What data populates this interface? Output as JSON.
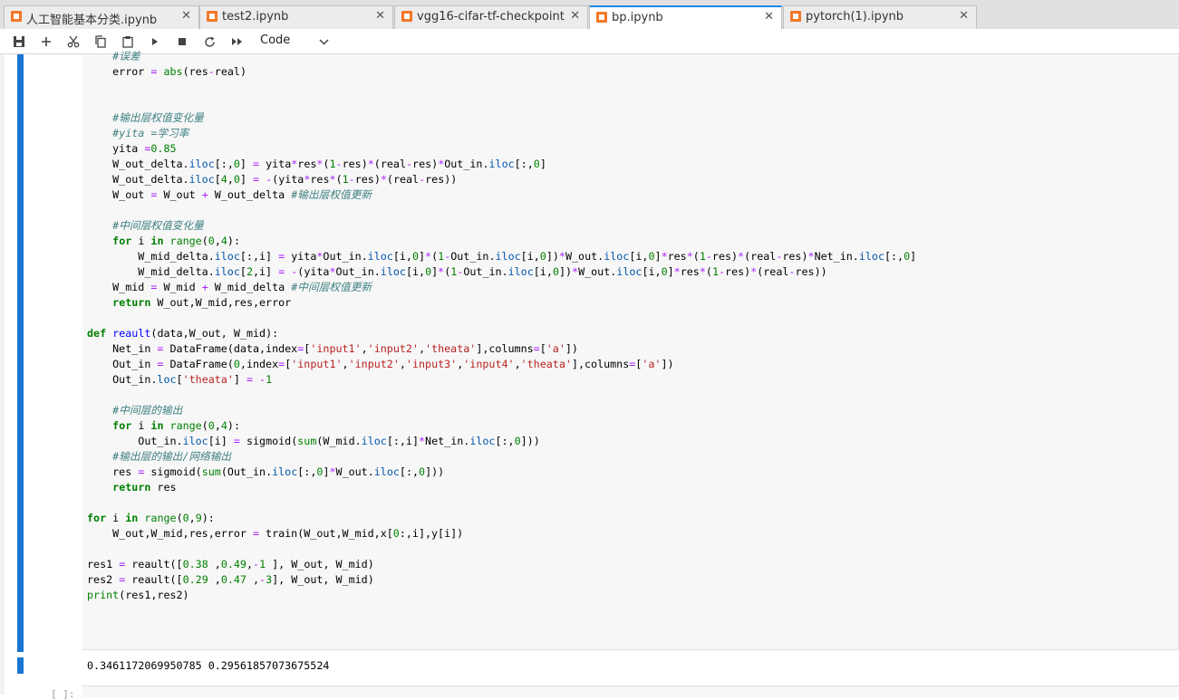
{
  "tabs": [
    {
      "label": "人工智能基本分类.ipynb",
      "active": false
    },
    {
      "label": "test2.ipynb",
      "active": false
    },
    {
      "label": "vgg16-cifar-tf-checkpoint.ipy",
      "active": false
    },
    {
      "label": "bp.ipynb",
      "active": true
    },
    {
      "label": "pytorch(1).ipynb",
      "active": false
    }
  ],
  "toolbar": {
    "cell_type": "Code",
    "icons": [
      "save-icon",
      "add-icon",
      "cut-icon",
      "copy-icon",
      "paste-icon",
      "run-icon",
      "stop-icon",
      "restart-icon",
      "run-all-icon"
    ]
  },
  "cell": {
    "code_lines": [
      "    #误差",
      "    error = abs(res-real)",
      "",
      "",
      "    #输出层权值变化量",
      "    #yita =学习率",
      "    yita =0.85",
      "    W_out_delta.iloc[:,0] = yita*res*(1-res)*(real-res)*Out_in.iloc[:,0]",
      "    W_out_delta.iloc[4,0] = -(yita*res*(1-res)*(real-res))",
      "    W_out = W_out + W_out_delta #输出层权值更新",
      "",
      "    #中间层权值变化量",
      "    for i in range(0,4):",
      "        W_mid_delta.iloc[:,i] = yita*Out_in.iloc[i,0]*(1-Out_in.iloc[i,0])*W_out.iloc[i,0]*res*(1-res)*(real-res)*Net_in.iloc[:,0]",
      "        W_mid_delta.iloc[2,i] = -(yita*Out_in.iloc[i,0]*(1-Out_in.iloc[i,0])*W_out.iloc[i,0]*res*(1-res)*(real-res))",
      "    W_mid = W_mid + W_mid_delta #中间层权值更新",
      "    return W_out,W_mid,res,error",
      "",
      "def reault(data,W_out, W_mid):",
      "    Net_in = DataFrame(data,index=['input1','input2','theata'],columns=['a'])",
      "    Out_in = DataFrame(0,index=['input1','input2','input3','input4','theata'],columns=['a'])",
      "    Out_in.loc['theata'] = -1",
      "",
      "    #中间层的输出",
      "    for i in range(0,4):",
      "        Out_in.iloc[i] = sigmoid(sum(W_mid.iloc[:,i]*Net_in.iloc[:,0]))",
      "    #输出层的输出/网络输出",
      "    res = sigmoid(sum(Out_in.iloc[:,0]*W_out.iloc[:,0]))",
      "    return res",
      "",
      "for i in range(0,9):",
      "    W_out,W_mid,res,error = train(W_out,W_mid,x[0:,i],y[i])",
      "",
      "res1 = reault([0.38 ,0.49,-1 ], W_out, W_mid)",
      "res2 = reault([0.29 ,0.47 ,-3], W_out, W_mid)",
      "print(res1,res2)"
    ],
    "output": "0.3461172069950785 0.29561857073675524"
  },
  "next_cell_prompt": "[ ]:"
}
